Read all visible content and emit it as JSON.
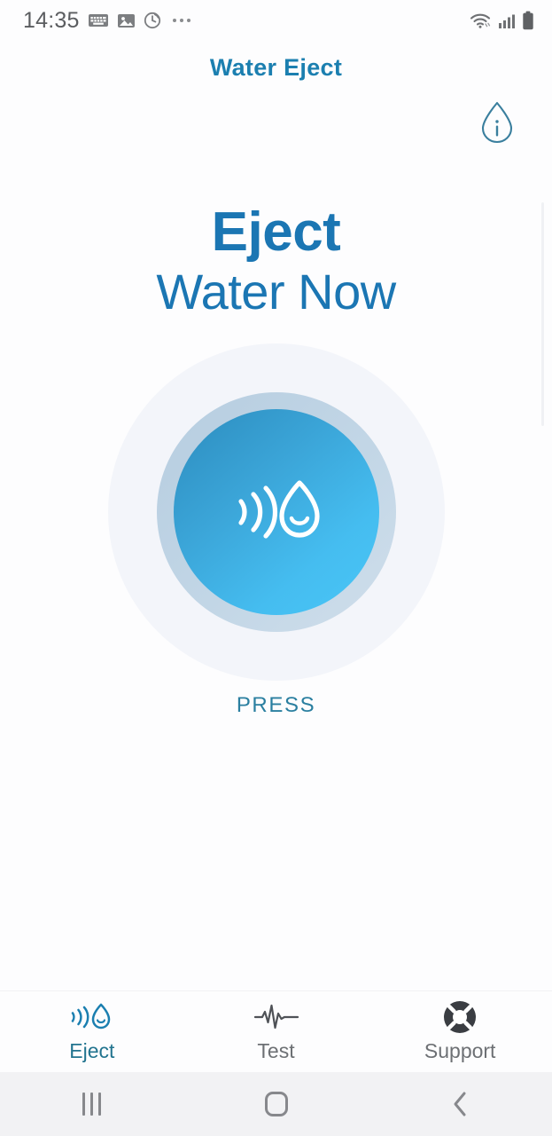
{
  "status_bar": {
    "time": "14:35",
    "left_icons": [
      "keyboard-icon",
      "image-icon",
      "alarm-icon",
      "overflow-dots-icon"
    ],
    "right_icons": [
      "wifi-icon",
      "cellular-signal-icon",
      "battery-icon"
    ]
  },
  "header": {
    "title": "Water Eject",
    "title_color": "#1b7fb0",
    "info_button": "info-droplet-icon"
  },
  "main": {
    "headline_line1": "Eject",
    "headline_line2": "Water Now",
    "headline_color": "#1b76b3",
    "button": {
      "name": "eject-water-button",
      "icon": "water-eject-icon",
      "core_gradient_start": "#2c8cbe",
      "core_gradient_end": "#49c6f7",
      "ring_color": "#c2d6e6",
      "halo_color": "#f3f5fa"
    },
    "press_label": "PRESS",
    "press_label_color": "#2a7fa0"
  },
  "tabs": [
    {
      "label": "Eject",
      "icon": "water-eject-icon",
      "active": true,
      "color": "#22748f"
    },
    {
      "label": "Test",
      "icon": "pulse-wave-icon",
      "active": false,
      "color": "#6d7074"
    },
    {
      "label": "Support",
      "icon": "lifebuoy-icon",
      "active": false,
      "color": "#6d7074"
    }
  ],
  "android_nav": {
    "recents": "recents-icon",
    "home": "home-icon",
    "back": "back-icon"
  }
}
